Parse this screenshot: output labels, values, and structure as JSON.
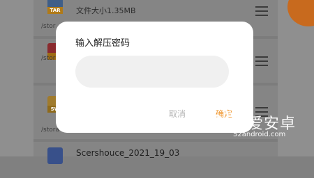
{
  "file_list": {
    "items": [
      {
        "badge": "TAR",
        "meta": "文件大小1.35MB",
        "path": "/stor"
      },
      {
        "badge": "",
        "meta": "",
        "path": "/stora"
      },
      {
        "badge": "SW",
        "meta": "",
        "path": "/stora"
      },
      {
        "badge": "",
        "name": "Scershouce_2021_19_03"
      }
    ]
  },
  "dialog": {
    "title": "输入解压密码",
    "input_value": "",
    "cancel_label": "取消",
    "confirm_label": "确定"
  },
  "watermark": {
    "text": "我爱安卓",
    "url": "52android.com"
  },
  "colors": {
    "confirm": "#f0962d",
    "cancel": "#b3b3b3",
    "dialog_bg": "#ffffff",
    "input_bg": "#f0f0f0",
    "overlay": "#808080"
  }
}
